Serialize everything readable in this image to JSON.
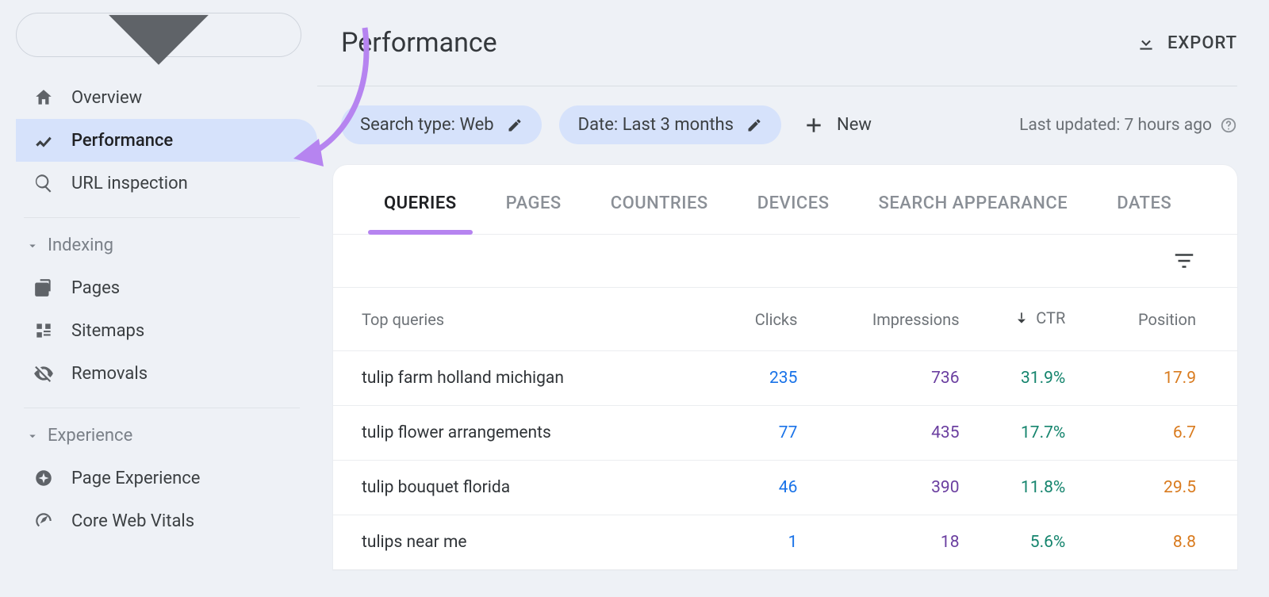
{
  "sidebar": {
    "items_top": [
      {
        "label": "Overview"
      },
      {
        "label": "Performance"
      },
      {
        "label": "URL inspection"
      }
    ],
    "section_indexing": {
      "title": "Indexing",
      "items": [
        {
          "label": "Pages"
        },
        {
          "label": "Sitemaps"
        },
        {
          "label": "Removals"
        }
      ]
    },
    "section_experience": {
      "title": "Experience",
      "items": [
        {
          "label": "Page Experience"
        },
        {
          "label": "Core Web Vitals"
        }
      ]
    }
  },
  "header": {
    "page_title": "Performance",
    "export_label": "EXPORT"
  },
  "filters": {
    "search_type_chip": "Search type: Web",
    "date_chip": "Date: Last 3 months",
    "new_label": "New",
    "last_updated": "Last updated: 7 hours ago"
  },
  "tabs": [
    "QUERIES",
    "PAGES",
    "COUNTRIES",
    "DEVICES",
    "SEARCH APPEARANCE",
    "DATES"
  ],
  "table": {
    "columns": {
      "query": "Top queries",
      "clicks": "Clicks",
      "impressions": "Impressions",
      "ctr": "CTR",
      "position": "Position"
    },
    "sort_column": "ctr",
    "rows": [
      {
        "query": "tulip farm holland michigan",
        "clicks": "235",
        "impressions": "736",
        "ctr": "31.9%",
        "position": "17.9"
      },
      {
        "query": "tulip flower arrangements",
        "clicks": "77",
        "impressions": "435",
        "ctr": "17.7%",
        "position": "6.7"
      },
      {
        "query": "tulip bouquet florida",
        "clicks": "46",
        "impressions": "390",
        "ctr": "11.8%",
        "position": "29.5"
      },
      {
        "query": "tulips near me",
        "clicks": "1",
        "impressions": "18",
        "ctr": "5.6%",
        "position": "8.8"
      }
    ]
  },
  "colors": {
    "accent_chip": "#d6e2fb",
    "tab_underline": "#b684f0",
    "clicks": "#1a73e8",
    "impressions": "#6b3fa0",
    "ctr": "#16856e",
    "position": "#d97b1f"
  }
}
